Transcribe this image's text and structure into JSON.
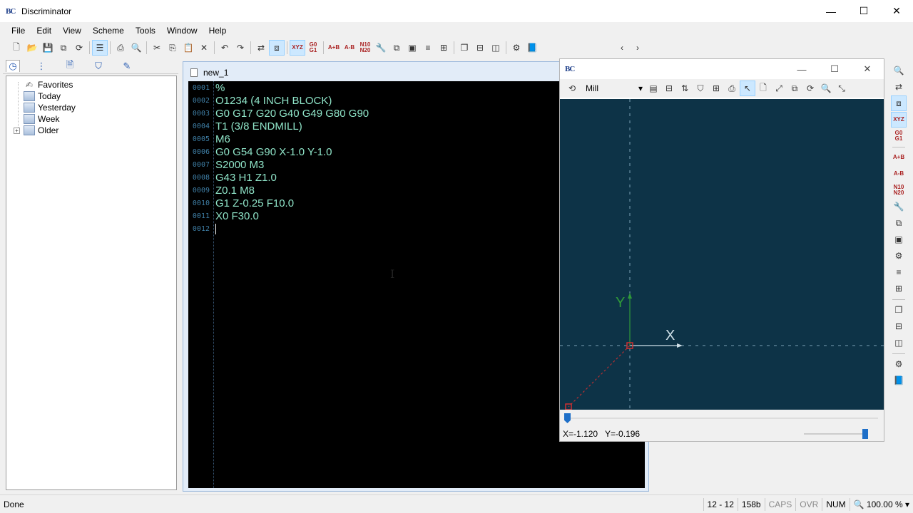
{
  "app": {
    "title": "Discriminator",
    "logo": "BC"
  },
  "window_controls": {
    "minimize": "—",
    "maximize": "☐",
    "close": "✕"
  },
  "menu": [
    "File",
    "Edit",
    "View",
    "Scheme",
    "Tools",
    "Window",
    "Help"
  ],
  "toolbar": {
    "icons": [
      "new-file-icon",
      "open-folder-icon",
      "save-icon",
      "save-all-icon",
      "reload-icon",
      "outline-icon",
      "print-icon",
      "print-preview-icon",
      "cut-icon",
      "copy-icon",
      "paste-icon",
      "delete-icon",
      "undo-icon",
      "redo-icon",
      "compare-icon",
      "compare-active-icon",
      "backplot-xyz-icon",
      "g0-g1-icon",
      "add-spaces-icon",
      "remove-spaces-icon",
      "renumber-icon",
      "wrench-icon",
      "copy-block-icon",
      "paste-block-icon",
      "list-icon",
      "transform-icon",
      "cascade-icon",
      "tile-horizontal-icon",
      "tile-vertical-icon",
      "plugins-icon",
      "help-book-icon",
      "nav-back-icon",
      "nav-forward-icon"
    ],
    "g0_g1": "G0 G1",
    "n10_n20": "N10 N20",
    "xyz": "XYZ",
    "ab1": "A+B",
    "ab2": "A-B"
  },
  "left_panel": {
    "tabs": [
      "recent-icon",
      "outline-tab-icon",
      "files-tab-icon",
      "filter-tab-icon",
      "notes-tab-icon"
    ],
    "tree": [
      {
        "label": "Favorites",
        "icon": "favorites-icon"
      },
      {
        "label": "Today",
        "icon": "calendar-icon"
      },
      {
        "label": "Yesterday",
        "icon": "calendar-icon"
      },
      {
        "label": "Week",
        "icon": "calendar-icon"
      },
      {
        "label": "Older",
        "icon": "calendar-icon",
        "expander": "+"
      }
    ]
  },
  "editor": {
    "tab_title": "new_1",
    "lines": [
      {
        "num": "0001",
        "code": "%"
      },
      {
        "num": "0002",
        "code": "O1234 (4 INCH BLOCK)"
      },
      {
        "num": "0003",
        "code": "G0 G17 G20 G40 G49 G80 G90"
      },
      {
        "num": "0004",
        "code": "T1 (3/8 ENDMILL)"
      },
      {
        "num": "0005",
        "code": "M6"
      },
      {
        "num": "0006",
        "code": "G0 G54 G90 X-1.0 Y-1.0"
      },
      {
        "num": "0007",
        "code": "S2000 M3"
      },
      {
        "num": "0008",
        "code": "G43 H1 Z1.0"
      },
      {
        "num": "0009",
        "code": "Z0.1 M8"
      },
      {
        "num": "0010",
        "code": "G1 Z-0.25 F10.0"
      },
      {
        "num": "0011",
        "code": "X0 F30.0"
      },
      {
        "num": "0012",
        "code": ""
      }
    ]
  },
  "backplot": {
    "logo": "BC",
    "machine": "Mill",
    "axis_x": "X",
    "axis_y": "Y",
    "coord_x": "X=-1.120",
    "coord_y": "Y=-0.196",
    "colors": {
      "canvas": "#0d3347",
      "axes": "#cfe0e8",
      "y_axis": "#2f9a3a",
      "rapid": "#d03030"
    }
  },
  "statusbar": {
    "status": "Done",
    "position": "12 - 12",
    "size": "158b",
    "caps": "CAPS",
    "ovr": "OVR",
    "num": "NUM",
    "zoom": "100.00 %"
  }
}
